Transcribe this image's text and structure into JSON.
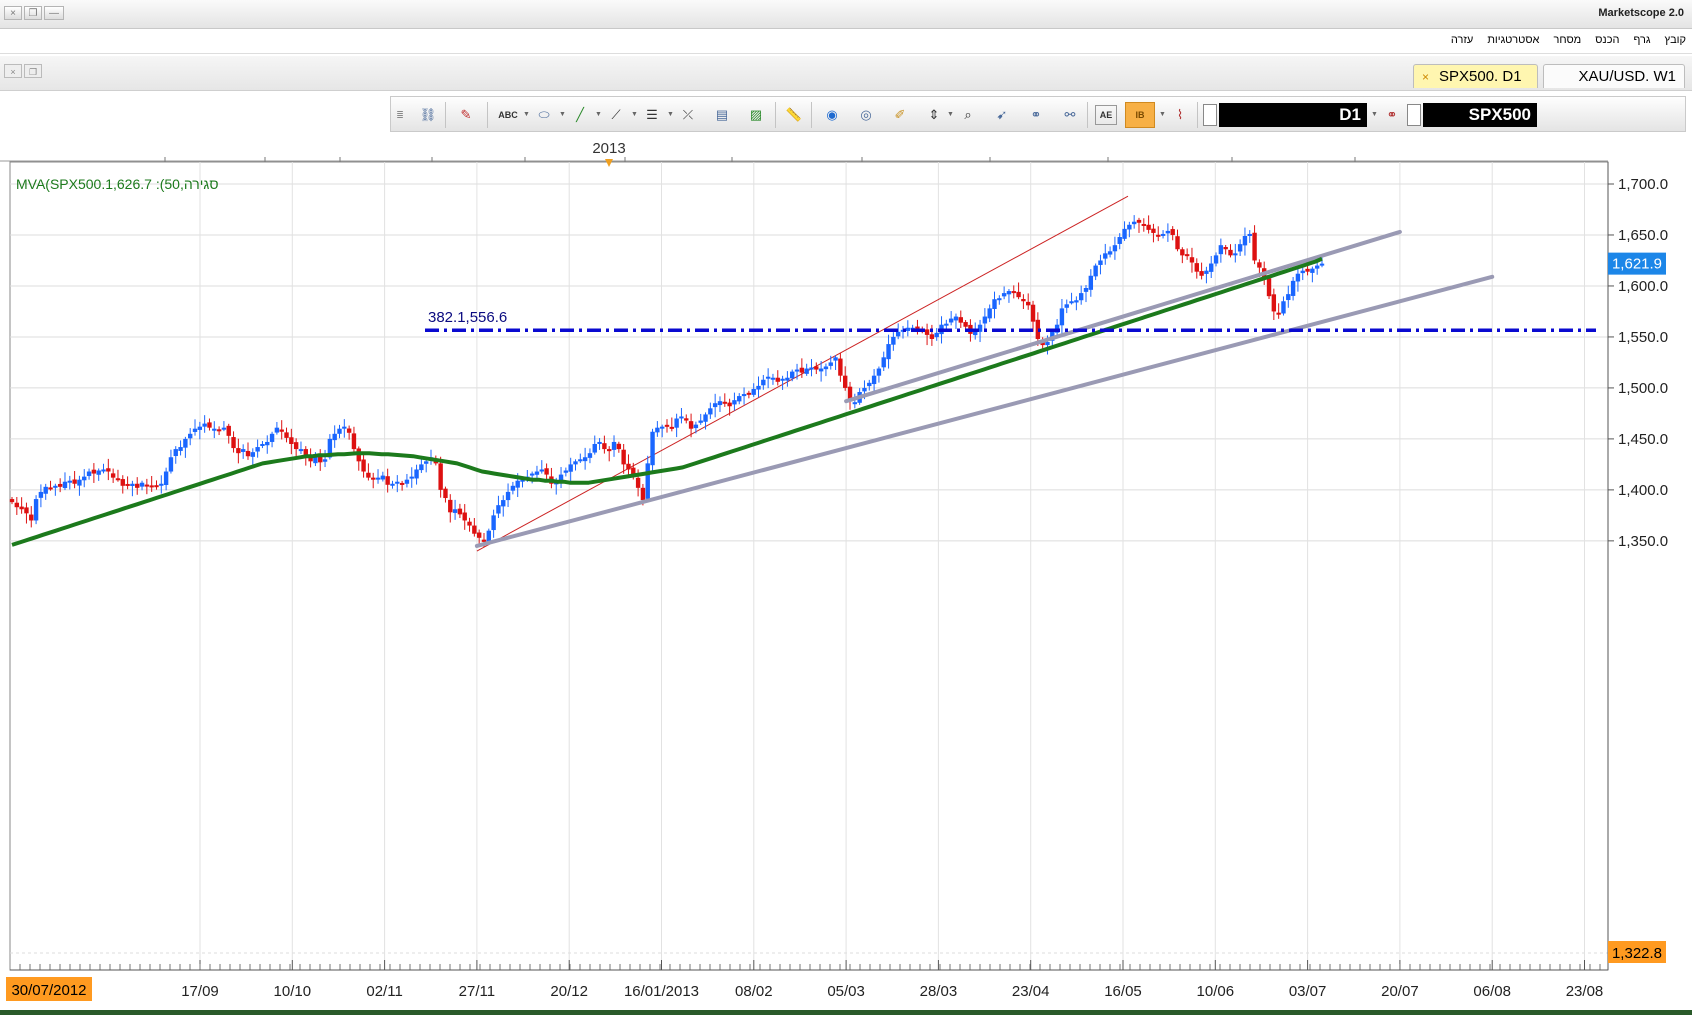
{
  "window": {
    "app_title": "Marketscope 2.0",
    "close_glyph": "×",
    "restore_glyph": "❐",
    "minimize_glyph": "—"
  },
  "menu": {
    "items": [
      "קובץ",
      "גרף",
      "הכנס",
      "מסחר",
      "אסטרטגיות",
      "עזרה"
    ]
  },
  "tabs": [
    {
      "label": "SPX500. D1",
      "active": true,
      "close_glyph": "×"
    },
    {
      "label": "XAU/USD. W1",
      "active": false
    }
  ],
  "toolbar": {
    "timeframe": "D1",
    "symbol": "SPX500",
    "icons": [
      "panel-icon",
      "hierarchy-icon",
      "eraser-icon",
      "text-abc-icon",
      "ellipse-icon",
      "line-draw-icon",
      "fan-icon",
      "levels-icon",
      "ruler-cross-icon",
      "chart-window-icon",
      "image-icon",
      "measure-ruler-icon",
      "globe-icon",
      "eye-icon",
      "note-icon",
      "vertical-range-icon",
      "zoom-chart-icon",
      "cursor-icon",
      "link-icon",
      "link-alt-icon",
      "format-ae-icon",
      "layout-ib-icon",
      "indicator-chart-icon"
    ],
    "active_icon": "layout-ib-icon"
  },
  "chart": {
    "year_marker": "2013",
    "indicator_legend": "MVA(SPX500.1,626.7 :(50,סגירה",
    "fib_label": "382.1,556.6",
    "current_price_label": "1,621.9",
    "low_price_label": "1,322.8",
    "start_date_label": "30/07/2012",
    "colors": {
      "bull": "#1a66ff",
      "bear": "#dd1111",
      "mva": "#1c7a1c",
      "trend": "#9a9ab4",
      "fib": "#0a0ad0",
      "channel": "#cc2222",
      "price_flag": "#1c86e8",
      "low_flag": "#ff9a20"
    }
  },
  "chart_data": {
    "type": "candlestick",
    "instrument": "SPX500",
    "timeframe": "D1",
    "x_tick_labels": [
      "17/09",
      "10/10",
      "02/11",
      "27/11",
      "20/12",
      "16/01/2013",
      "08/02",
      "05/03",
      "28/03",
      "23/04",
      "16/05",
      "10/06",
      "03/07",
      "20/07",
      "06/08",
      "23/08"
    ],
    "y_tick_labels": [
      "1,350.0",
      "1,400.0",
      "1,450.0",
      "1,500.0",
      "1,550.0",
      "1,600.0",
      "1,650.0",
      "1,700.0"
    ],
    "ylim": [
      1322,
      1712
    ],
    "grid": true,
    "mva_period": 50,
    "mva_last": 1626.7,
    "last_price": 1621.9,
    "fib_level": {
      "ratio": 0.382,
      "price": 1556.6
    },
    "close_series": [
      1388,
      1383,
      1381,
      1377,
      1370,
      1391,
      1398,
      1403,
      1402,
      1404,
      1403,
      1408,
      1409,
      1406,
      1410,
      1413,
      1418,
      1416,
      1419,
      1420,
      1418,
      1412,
      1410,
      1404,
      1405,
      1406,
      1402,
      1407,
      1405,
      1404,
      1403,
      1406,
      1418,
      1432,
      1440,
      1442,
      1450,
      1455,
      1460,
      1462,
      1465,
      1461,
      1460,
      1459,
      1461,
      1453,
      1441,
      1436,
      1440,
      1433,
      1437,
      1442,
      1445,
      1447,
      1455,
      1461,
      1457,
      1451,
      1445,
      1440,
      1440,
      1433,
      1428,
      1435,
      1427,
      1430,
      1450,
      1455,
      1460,
      1462,
      1456,
      1440,
      1428,
      1418,
      1412,
      1410,
      1412,
      1414,
      1405,
      1406,
      1408,
      1406,
      1410,
      1413,
      1420,
      1425,
      1428,
      1432,
      1426,
      1400,
      1392,
      1378,
      1381,
      1376,
      1370,
      1365,
      1357,
      1353,
      1349,
      1360,
      1375,
      1385,
      1390,
      1398,
      1404,
      1409,
      1410,
      1413,
      1416,
      1418,
      1420,
      1415,
      1406,
      1408,
      1415,
      1419,
      1425,
      1428,
      1430,
      1432,
      1436,
      1445,
      1447,
      1440,
      1438,
      1447,
      1440,
      1425,
      1420,
      1413,
      1402,
      1390,
      1426,
      1457,
      1461,
      1462,
      1463,
      1461,
      1470,
      1472,
      1468,
      1460,
      1464,
      1468,
      1474,
      1480,
      1485,
      1487,
      1485,
      1482,
      1488,
      1492,
      1494,
      1495,
      1499,
      1502,
      1508,
      1511,
      1510,
      1506,
      1509,
      1510,
      1516,
      1518,
      1515,
      1519,
      1520,
      1518,
      1519,
      1521,
      1525,
      1530,
      1512,
      1500,
      1487,
      1486,
      1496,
      1500,
      1505,
      1512,
      1519,
      1530,
      1543,
      1550,
      1555,
      1557,
      1559,
      1559,
      1560,
      1558,
      1552,
      1548,
      1554,
      1562,
      1563,
      1568,
      1570,
      1564,
      1560,
      1553,
      1555,
      1562,
      1570,
      1578,
      1587,
      1588,
      1593,
      1595,
      1593,
      1589,
      1585,
      1581,
      1565,
      1548,
      1542,
      1545,
      1556,
      1562,
      1578,
      1582,
      1585,
      1586,
      1593,
      1598,
      1610,
      1620,
      1625,
      1632,
      1634,
      1640,
      1648,
      1656,
      1660,
      1663,
      1662,
      1660,
      1655,
      1652,
      1650,
      1651,
      1654,
      1650,
      1636,
      1630,
      1630,
      1623,
      1614,
      1610,
      1615,
      1622,
      1630,
      1640,
      1636,
      1630,
      1632,
      1641,
      1649,
      1651,
      1625,
      1618,
      1607,
      1590,
      1575,
      1573,
      1585,
      1592,
      1605,
      1612,
      1615,
      1614,
      1617,
      1620,
      1621.9
    ],
    "mva_series": [
      1346,
      1348,
      1350,
      1352,
      1354,
      1356,
      1358,
      1360,
      1362,
      1364,
      1366,
      1368,
      1370,
      1372,
      1374,
      1376,
      1378,
      1380,
      1382,
      1384,
      1386,
      1388,
      1390,
      1392,
      1394,
      1396,
      1398,
      1400,
      1402,
      1404,
      1406,
      1408,
      1410,
      1412,
      1414,
      1416,
      1418,
      1420,
      1422,
      1424,
      1426,
      1427,
      1428,
      1429,
      1430,
      1431,
      1432,
      1433,
      1433,
      1434,
      1434,
      1434.5,
      1435,
      1435,
      1435.5,
      1436,
      1436,
      1436,
      1435.5,
      1435,
      1435,
      1434.5,
      1434,
      1433.5,
      1433,
      1432,
      1431,
      1430,
      1429,
      1428,
      1427,
      1426,
      1424,
      1422,
      1420,
      1418,
      1417,
      1416,
      1415,
      1414,
      1413,
      1412,
      1411,
      1410,
      1410,
      1409,
      1409,
      1408,
      1408,
      1407,
      1407,
      1407,
      1407,
      1408,
      1409,
      1410,
      1411,
      1412,
      1413,
      1414,
      1415,
      1416,
      1417,
      1418,
      1419,
      1420,
      1421,
      1422,
      1424,
      1426,
      1428,
      1430,
      1432,
      1434,
      1436,
      1438,
      1440,
      1442,
      1444,
      1446,
      1448,
      1450,
      1452,
      1454,
      1456,
      1458,
      1460,
      1462,
      1464,
      1466,
      1468,
      1470,
      1472,
      1474,
      1476,
      1478,
      1480,
      1482,
      1484,
      1486,
      1488,
      1490,
      1492,
      1494,
      1496,
      1498,
      1500,
      1502,
      1504,
      1506,
      1508,
      1510,
      1512,
      1514,
      1516,
      1518,
      1520,
      1522,
      1524,
      1526,
      1528,
      1530,
      1532,
      1534,
      1536,
      1538,
      1540,
      1542,
      1544,
      1546,
      1548,
      1550,
      1552,
      1554,
      1556,
      1558,
      1560,
      1562,
      1564,
      1566,
      1568,
      1570,
      1572,
      1574,
      1576,
      1578,
      1580,
      1582,
      1584,
      1586,
      1588,
      1590,
      1592,
      1594,
      1596,
      1598,
      1600,
      1602,
      1604,
      1606,
      1608,
      1610,
      1612,
      1614,
      1616,
      1618,
      1620,
      1622,
      1624,
      1626.7
    ],
    "trendlines": [
      {
        "from": {
          "date": "27/11",
          "price": 1345
        },
        "to": {
          "date": "06/08",
          "price": 1609
        }
      },
      {
        "from": {
          "date": "05/03",
          "price": 1487
        },
        "to": {
          "date": "20/07",
          "price": 1653
        }
      }
    ],
    "channel_line": {
      "from": {
        "date": "27/11",
        "price": 1340
      },
      "to": {
        "date": "16/05",
        "price": 1688
      }
    }
  }
}
